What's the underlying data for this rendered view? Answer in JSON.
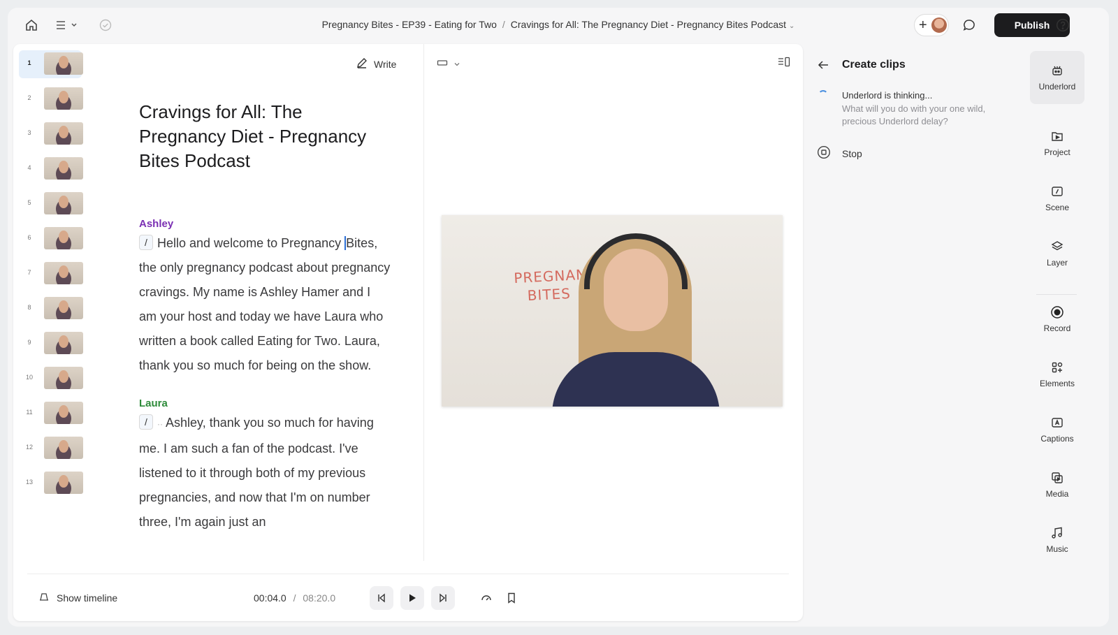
{
  "topbar": {
    "breadcrumb_project": "Pregnancy Bites - EP39 - Eating for Two",
    "breadcrumb_separator": "/",
    "breadcrumb_document": "Cravings for All: The Pregnancy Diet - Pregnancy Bites Podcast",
    "publish_label": "Publish",
    "icons": [
      "home-icon",
      "menu-icon",
      "check-circle-icon",
      "plus-icon",
      "comment-icon",
      "help-icon"
    ]
  },
  "scenes": [
    "1",
    "2",
    "3",
    "4",
    "5",
    "6",
    "7",
    "8",
    "9",
    "10",
    "11",
    "12",
    "13"
  ],
  "editor": {
    "write_label": "Write",
    "doc_title": "Cravings for All: The Pregnancy Diet - Pregnancy Bites Podcast",
    "slash": "/",
    "speaker1": "Ashley",
    "para1a": "Hello and welcome to Pregnancy",
    "para1b": "Bites, the only pregnancy podcast about pregnancy cravings. My name is Ashley Hamer and I am your host and today we have Laura who written a book called Eating for Two. Laura, thank you so much for being on the show.",
    "speaker2": "Laura",
    "para2": "Ashley, thank you so much for having me. I am such a fan of the podcast. I've listened to it through both of my previous pregnancies, and now that I'm on number three, I'm again just an"
  },
  "video": {
    "whiteboard_line1": "PREGNANC",
    "whiteboard_line2": "BITES"
  },
  "playback": {
    "show_timeline": "Show timeline",
    "current_time": "00:04.0",
    "time_separator": "/",
    "total_time": "08:20.0"
  },
  "panel": {
    "title": "Create clips",
    "thinking": "Underlord is thinking...",
    "thinking_sub": "What will you do with your one wild, precious Underlord delay?",
    "stop_label": "Stop"
  },
  "sidebar": {
    "items": [
      {
        "label": "Underlord",
        "icon": "robot-icon"
      },
      {
        "label": "Project",
        "icon": "play-folder-icon"
      },
      {
        "label": "Scene",
        "icon": "slash-box-icon"
      },
      {
        "label": "Layer",
        "icon": "layers-icon"
      },
      {
        "label": "Record",
        "icon": "record-icon"
      },
      {
        "label": "Elements",
        "icon": "shapes-icon"
      },
      {
        "label": "Captions",
        "icon": "caption-icon"
      },
      {
        "label": "Media",
        "icon": "media-icon"
      },
      {
        "label": "Music",
        "icon": "music-icon"
      }
    ]
  },
  "colors": {
    "ashley": "#7a2fb3",
    "laura": "#2e8b3a",
    "publish_bg": "#1c1c1e"
  }
}
